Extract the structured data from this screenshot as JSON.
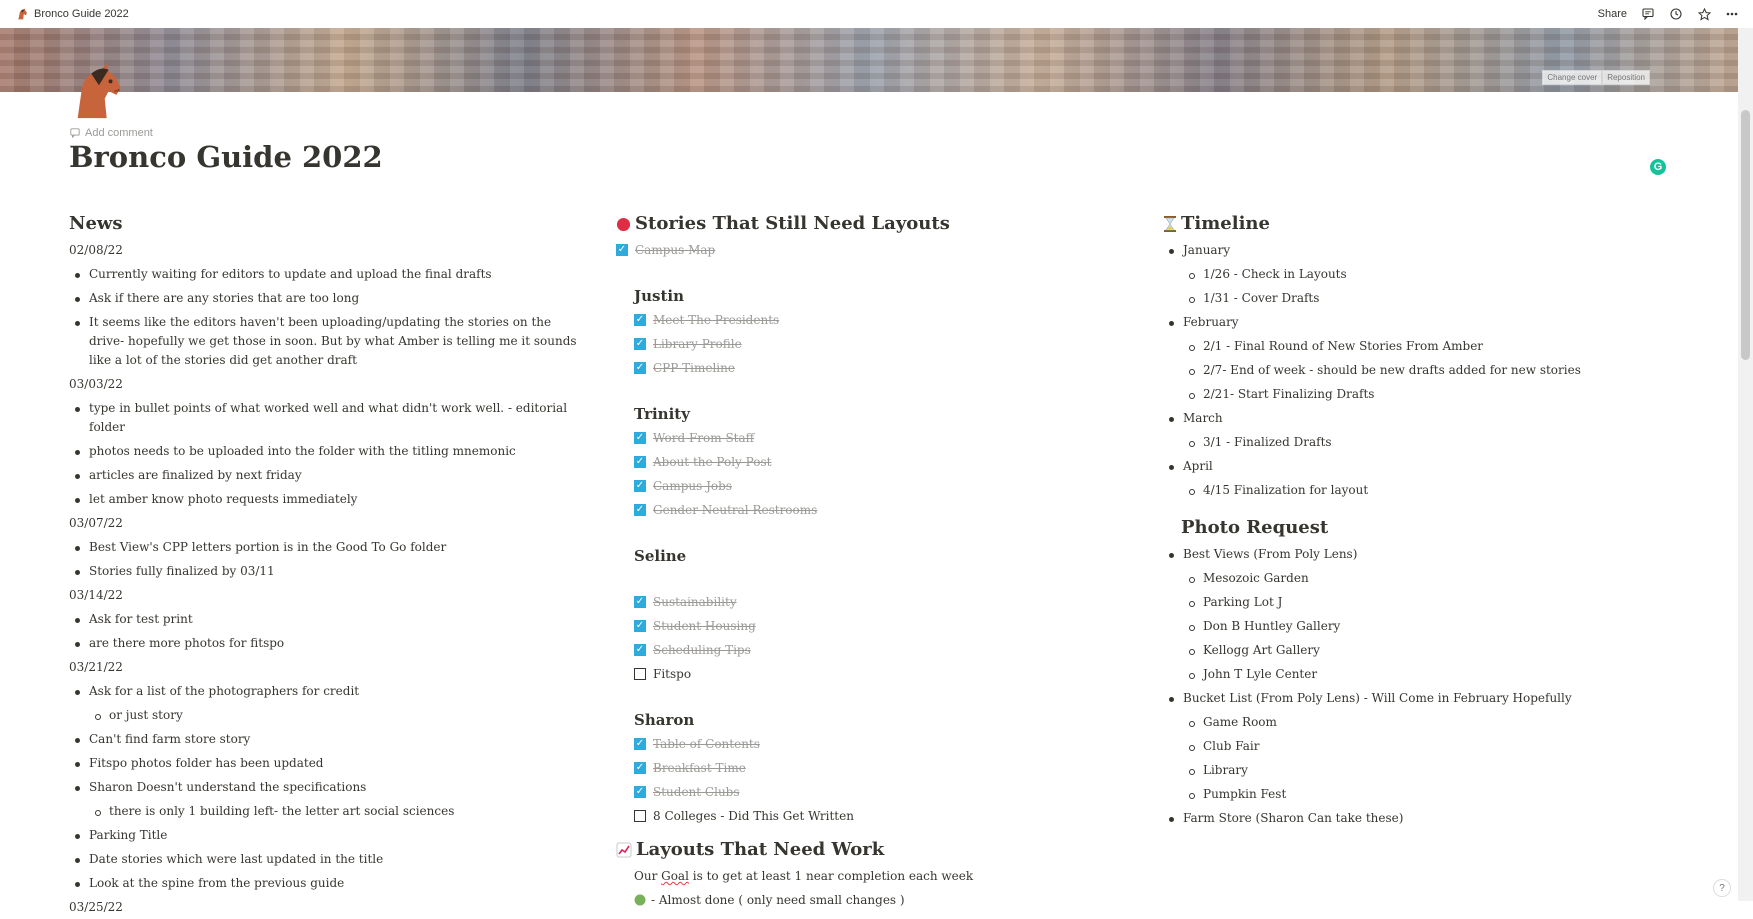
{
  "topbar": {
    "breadcrumb": "Bronco Guide 2022",
    "share_label": "Share",
    "icons": [
      "comment-icon",
      "clock-icon",
      "star-icon",
      "more-icon"
    ]
  },
  "cover": {
    "change_cover": "Change cover",
    "reposition": "Reposition"
  },
  "page": {
    "add_comment": "Add comment",
    "title": "Bronco Guide 2022"
  },
  "news": {
    "heading": "News",
    "groups": [
      {
        "date": "02/08/22",
        "items": [
          {
            "text": "Currently waiting for editors to update and upload the final drafts"
          },
          {
            "text": "Ask if there are any stories that are too long"
          },
          {
            "text": "It seems like the editors haven't been uploading/updating the stories on the drive- hopefully we get those in soon. But by what Amber is telling me it sounds like a lot of the stories did get another draft"
          }
        ]
      },
      {
        "date": "03/03/22",
        "items": [
          {
            "text": "type in bullet points of what worked well and what didn't work well. - editorial folder"
          },
          {
            "text": "photos needs to be uploaded into the folder with the titling mnemonic"
          },
          {
            "text": "articles are finalized by next friday"
          },
          {
            "text": "let amber know photo requests immediately"
          }
        ]
      },
      {
        "date": "03/07/22",
        "items": [
          {
            "text": "Best View's CPP letters portion is in the Good To Go folder"
          },
          {
            "text": "Stories fully finalized by 03/11"
          }
        ]
      },
      {
        "date": "03/14/22",
        "items": [
          {
            "text": "Ask for test print"
          },
          {
            "text": "are there more photos for fitspo"
          }
        ]
      },
      {
        "date": "03/21/22",
        "items": [
          {
            "text": "Ask for a list of the photographers for credit"
          },
          {
            "text": "or just story",
            "sub": true
          },
          {
            "text": "Can't find farm store story"
          },
          {
            "text": "Fitspo photos folder has been updated"
          },
          {
            "text": "Sharon Doesn't understand the specifications"
          },
          {
            "text": "there is only 1 building left- the letter art social sciences",
            "sub": true
          },
          {
            "text": "Parking Title"
          },
          {
            "text": "Date stories which were last updated in the title"
          },
          {
            "text": "Look at the spine from the previous guide"
          }
        ]
      },
      {
        "date": "03/25/22",
        "items": []
      }
    ]
  },
  "stories": {
    "heading": "Stories That Still Need Layouts",
    "top_item": {
      "label": "Campus Map",
      "checked": true
    },
    "sections": [
      {
        "name": "Justin",
        "items": [
          {
            "label": "Meet The Presidents",
            "checked": true
          },
          {
            "label": "Library Profile",
            "checked": true
          },
          {
            "label": "CPP Timeline",
            "checked": true
          }
        ]
      },
      {
        "name": "Trinity",
        "items": [
          {
            "label": "Word From Staff",
            "checked": true
          },
          {
            "label": "About the Poly Post",
            "checked": true
          },
          {
            "label": "Campus Jobs",
            "checked": true
          },
          {
            "label": "Gender Neutral Restrooms",
            "checked": true
          }
        ]
      },
      {
        "name": "Seline",
        "gap": true,
        "items": [
          {
            "label": "Sustainability",
            "checked": true
          },
          {
            "label": "Student Housing",
            "checked": true
          },
          {
            "label": "Scheduling Tips",
            "checked": true
          },
          {
            "label": "Fitspo",
            "checked": false
          }
        ]
      },
      {
        "name": "Sharon",
        "items": [
          {
            "label": "Table of Contents",
            "checked": true
          },
          {
            "label": "Breakfast Time",
            "checked": true
          },
          {
            "label": "Student Clubs",
            "checked": true
          },
          {
            "label": "8 Colleges - Did This Get Written",
            "checked": false
          }
        ]
      }
    ]
  },
  "layouts": {
    "heading": "Layouts That Need Work",
    "goal": "Our Goal is to get at least 1 near completion each week",
    "legend": [
      {
        "icon": "green-circle-icon",
        "text": "- Almost done ( only need small changes )"
      }
    ]
  },
  "timeline": {
    "heading": "Timeline",
    "items": [
      {
        "text": "January"
      },
      {
        "text": "1/26 - Check in Layouts",
        "sub": true
      },
      {
        "text": "1/31 - Cover Drafts",
        "sub": true
      },
      {
        "text": "February"
      },
      {
        "text": "2/1 - Final Round of New Stories From Amber",
        "sub": true
      },
      {
        "text": "2/7- End of week - should be new drafts added for new stories",
        "sub": true
      },
      {
        "text": "2/21- Start Finalizing Drafts",
        "sub": true
      },
      {
        "text": "March"
      },
      {
        "text": "3/1 - Finalized Drafts",
        "sub": true
      },
      {
        "text": "April"
      },
      {
        "text": "4/15 Finalization for layout",
        "sub": true
      }
    ]
  },
  "photo_request": {
    "heading": "Photo Request",
    "items": [
      {
        "text": "Best Views (From Poly Lens)"
      },
      {
        "text": "Mesozoic Garden",
        "sub": true
      },
      {
        "text": "Parking Lot J",
        "sub": true
      },
      {
        "text": "Don B Huntley Gallery",
        "sub": true
      },
      {
        "text": "Kellogg Art Gallery",
        "sub": true
      },
      {
        "text": "John T Lyle Center",
        "sub": true
      },
      {
        "text": "Bucket List (From Poly Lens) - Will Come in February Hopefully"
      },
      {
        "text": "Game Room",
        "sub": true
      },
      {
        "text": "Club Fair",
        "sub": true
      },
      {
        "text": "Library",
        "sub": true
      },
      {
        "text": "Pumpkin Fest",
        "sub": true
      },
      {
        "text": "Farm Store (Sharon Can take these)"
      }
    ]
  },
  "help_label": "?",
  "colors": {
    "accent_checkbox": "#2eaadc",
    "text": "#37352f",
    "muted": "#9b9a97",
    "grammarly": "#15c39a"
  }
}
